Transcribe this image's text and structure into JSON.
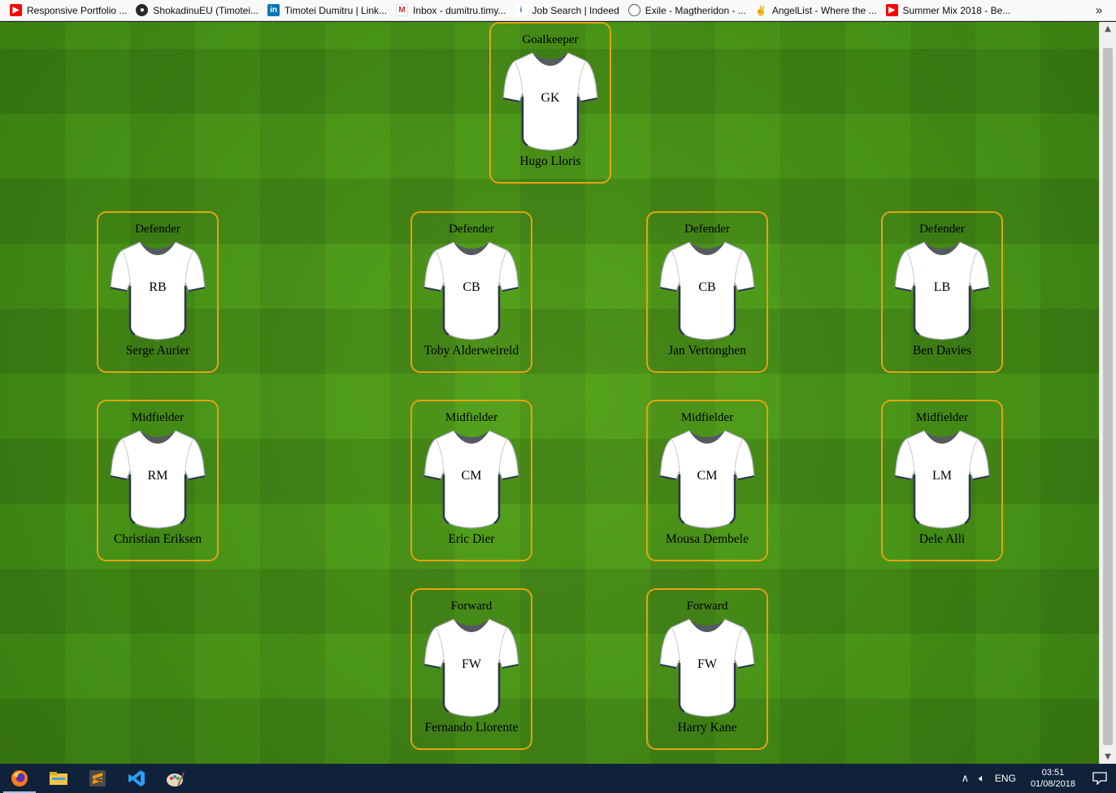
{
  "bookmarks": [
    {
      "label": "Responsive Portfolio ...",
      "icon": "youtube-icon",
      "color": "#ff0000"
    },
    {
      "label": "ShokadinuEU (Timotei...",
      "icon": "github-icon",
      "color": "#24292e"
    },
    {
      "label": "Timotei Dumitru | Link...",
      "icon": "linkedin-icon",
      "color": "#0077b5"
    },
    {
      "label": "Inbox - dumitru.timy...",
      "icon": "gmail-icon",
      "color": "#d93025"
    },
    {
      "label": "Job Search | Indeed",
      "icon": "indeed-icon",
      "color": "#2164f3"
    },
    {
      "label": "Exile - Magtheridon - ...",
      "icon": "globe-icon",
      "color": "#555555"
    },
    {
      "label": "AngelList - Where the ...",
      "icon": "angellist-icon",
      "color": "#000000"
    },
    {
      "label": "Summer Mix 2018 - Be...",
      "icon": "youtube-icon",
      "color": "#ff0000"
    }
  ],
  "bookmarks_more": "»",
  "formation": {
    "goalkeeper": {
      "role": "Goalkeeper",
      "pos": "GK",
      "player": "Hugo Lloris"
    },
    "defenders": [
      {
        "role": "Defender",
        "pos": "RB",
        "player": "Serge Aurier"
      },
      {
        "role": "Defender",
        "pos": "CB",
        "player": "Toby Alderweireld"
      },
      {
        "role": "Defender",
        "pos": "CB",
        "player": "Jan Vertonghen"
      },
      {
        "role": "Defender",
        "pos": "LB",
        "player": "Ben Davies"
      }
    ],
    "midfielders": [
      {
        "role": "Midfielder",
        "pos": "RM",
        "player": "Christian Eriksen"
      },
      {
        "role": "Midfielder",
        "pos": "CM",
        "player": "Eric Dier"
      },
      {
        "role": "Midfielder",
        "pos": "CM",
        "player": "Mousa Dembele"
      },
      {
        "role": "Midfielder",
        "pos": "LM",
        "player": "Dele Alli"
      }
    ],
    "forwards": [
      {
        "role": "Forward",
        "pos": "FW",
        "player": "Fernando Llorente"
      },
      {
        "role": "Forward",
        "pos": "FW",
        "player": "Harry Kane"
      }
    ]
  },
  "colors": {
    "card_border": "#e3a312",
    "pitch": "#4c9a1a",
    "taskbar": "#10223a"
  },
  "taskbar": {
    "apps": [
      {
        "name": "firefox-icon",
        "active": true
      },
      {
        "name": "file-explorer-icon",
        "active": false
      },
      {
        "name": "sublime-text-icon",
        "active": false
      },
      {
        "name": "vscode-icon",
        "active": false
      },
      {
        "name": "paint-icon",
        "active": false
      }
    ],
    "language": "ENG",
    "time": "03:51",
    "date": "01/08/2018"
  }
}
